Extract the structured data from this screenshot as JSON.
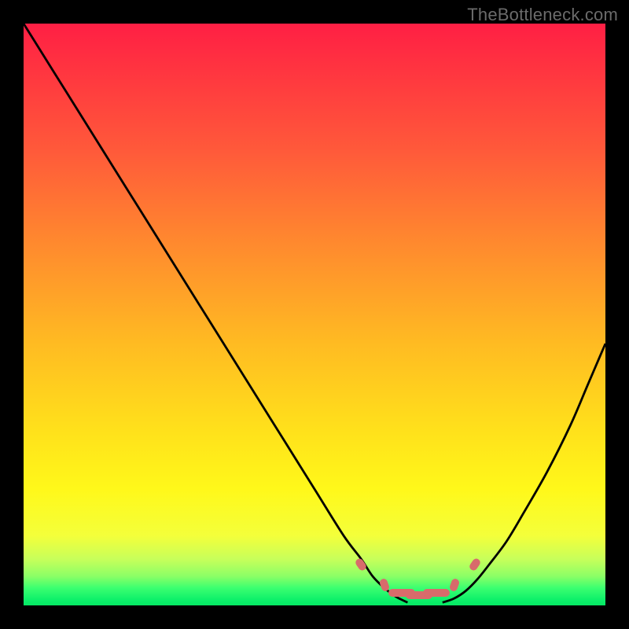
{
  "watermark": "TheBottleneck.com",
  "colors": {
    "frame_bg": "#000000",
    "curve": "#000000",
    "marker": "#d86b6b"
  },
  "chart_data": {
    "type": "line",
    "title": "",
    "xlabel": "",
    "ylabel": "",
    "xlim": [
      0,
      100
    ],
    "ylim": [
      0,
      100
    ],
    "series": [
      {
        "name": "left-curve",
        "x": [
          0,
          5,
          10,
          15,
          20,
          25,
          30,
          35,
          40,
          45,
          50,
          55,
          58,
          60,
          62,
          64,
          66
        ],
        "y": [
          100,
          92,
          84,
          76,
          68,
          60,
          52,
          44,
          36,
          28,
          20,
          12,
          8,
          5,
          3,
          1.5,
          0.5
        ]
      },
      {
        "name": "right-curve",
        "x": [
          72,
          74,
          76,
          78,
          80,
          83,
          86,
          90,
          94,
          97,
          100
        ],
        "y": [
          0.5,
          1.2,
          2.5,
          4.5,
          7,
          11,
          16,
          23,
          31,
          38,
          45
        ]
      }
    ],
    "markers": {
      "name": "bottleneck-range",
      "points": [
        {
          "x": 58,
          "y": 7
        },
        {
          "x": 62,
          "y": 3.5
        },
        {
          "x": 65,
          "y": 2.2
        },
        {
          "x": 68,
          "y": 1.8
        },
        {
          "x": 71,
          "y": 2.2
        },
        {
          "x": 74,
          "y": 3.5
        },
        {
          "x": 77.5,
          "y": 7
        }
      ]
    }
  }
}
